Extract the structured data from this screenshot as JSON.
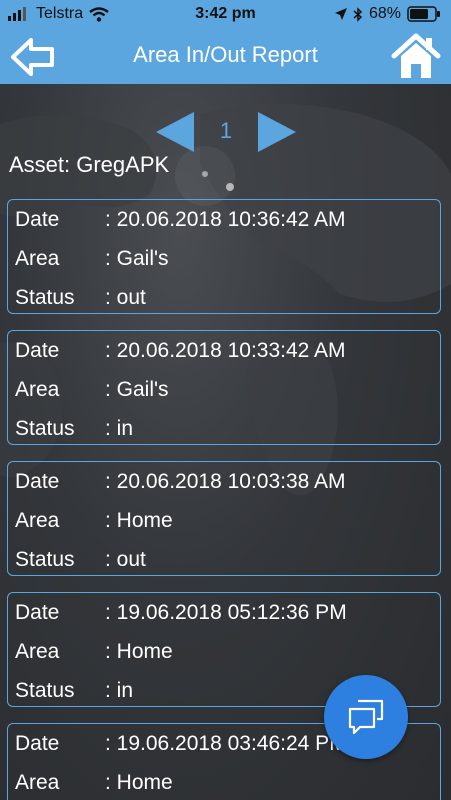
{
  "status_bar": {
    "carrier": "Telstra",
    "time": "3:42 pm",
    "battery": "68%"
  },
  "nav": {
    "title": "Area In/Out Report"
  },
  "pager": {
    "page": "1"
  },
  "asset": {
    "text": "Asset: GregAPK"
  },
  "labels": {
    "date": "Date",
    "area": "Area",
    "status": "Status"
  },
  "records": [
    {
      "date": ": 20.06.2018 10:36:42 AM",
      "area": ": Gail's",
      "status": ": out"
    },
    {
      "date": ": 20.06.2018 10:33:42 AM",
      "area": ": Gail's",
      "status": ": in"
    },
    {
      "date": ": 20.06.2018 10:03:38 AM",
      "area": ": Home",
      "status": ": out"
    },
    {
      "date": ": 19.06.2018 05:12:36 PM",
      "area": ": Home",
      "status": ": in"
    },
    {
      "date": ": 19.06.2018 03:46:24 PM",
      "area": ": Home",
      "status": ""
    }
  ],
  "colors": {
    "accent": "#5ba6df",
    "fab": "#2d7fe0",
    "background": "#2f3236"
  },
  "icons": {
    "back": "arrow-left-icon",
    "home": "home-icon",
    "prev": "triangle-left-icon",
    "next": "triangle-right-icon",
    "fab": "chat-bubbles-icon"
  }
}
